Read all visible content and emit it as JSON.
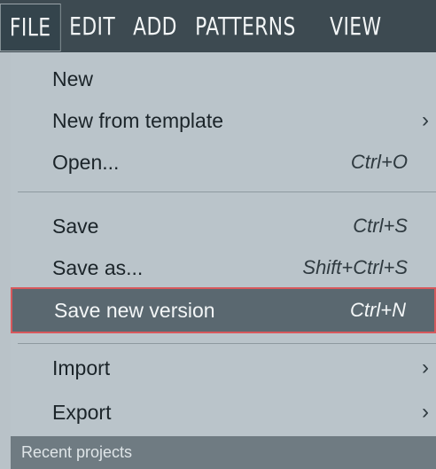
{
  "menubar": {
    "items": [
      "FILE",
      "EDIT",
      "ADD",
      "PATTERNS",
      "VIEW"
    ]
  },
  "menu": {
    "items": [
      {
        "label": "New",
        "shortcut": "",
        "submenu": false
      },
      {
        "label": "New from template",
        "shortcut": "",
        "submenu": true
      },
      {
        "label": "Open...",
        "shortcut": "Ctrl+O",
        "submenu": false
      },
      {
        "label": "Save",
        "shortcut": "Ctrl+S",
        "submenu": false
      },
      {
        "label": "Save as...",
        "shortcut": "Shift+Ctrl+S",
        "submenu": false
      },
      {
        "label": "Save new version",
        "shortcut": "Ctrl+N",
        "submenu": false
      },
      {
        "label": "Import",
        "shortcut": "",
        "submenu": true
      },
      {
        "label": "Export",
        "shortcut": "",
        "submenu": true
      }
    ],
    "recent_label": "Recent projects",
    "chevron": "›"
  },
  "colors": {
    "menubar_bg": "#3d4a51",
    "menu_bg": "#bac4ca",
    "highlight_bg": "#5a6870",
    "highlight_border": "#d7585c"
  },
  "icons": {
    "submenu": "chevron-right-icon"
  }
}
